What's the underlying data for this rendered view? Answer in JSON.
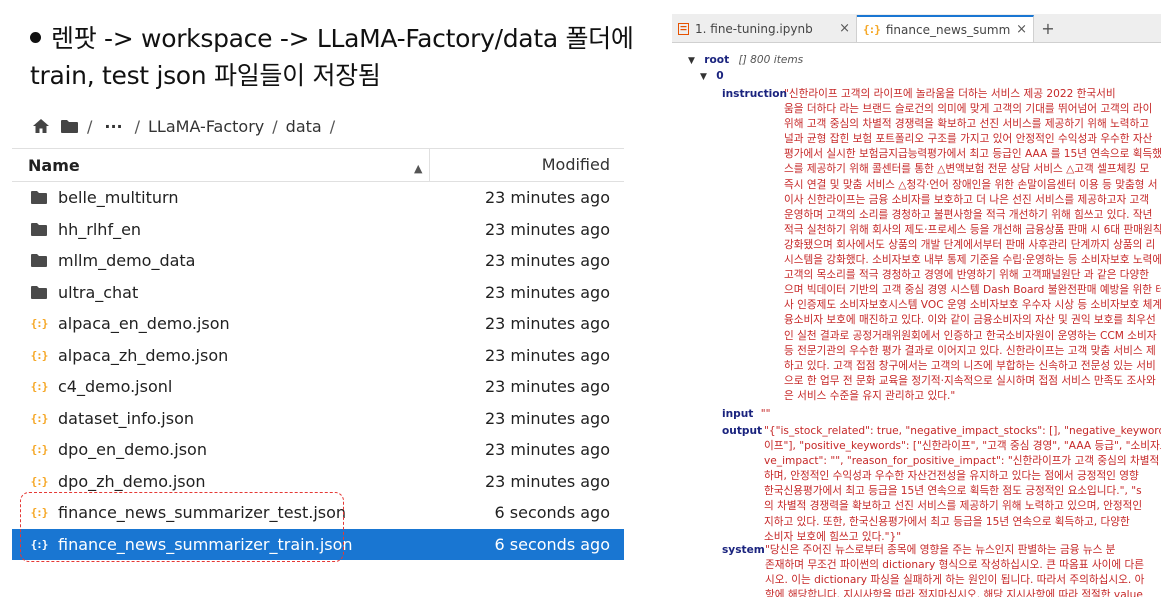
{
  "caption": {
    "line1": "렌팟 -> workspace -> LLaMA-Factory/data 폴더에",
    "line2": "train, test json 파일들이 저장됨"
  },
  "breadcrumb": {
    "ellipsis": "···",
    "part1": "LLaMA-Factory",
    "part2": "data",
    "sep": "/"
  },
  "filebrowser": {
    "header_name": "Name",
    "header_modified": "Modified",
    "files": [
      {
        "name": "belle_multiturn",
        "modified": "23 minutes ago",
        "type": "folder"
      },
      {
        "name": "hh_rlhf_en",
        "modified": "23 minutes ago",
        "type": "folder"
      },
      {
        "name": "mllm_demo_data",
        "modified": "23 minutes ago",
        "type": "folder"
      },
      {
        "name": "ultra_chat",
        "modified": "23 minutes ago",
        "type": "folder"
      },
      {
        "name": "alpaca_en_demo.json",
        "modified": "23 minutes ago",
        "type": "json"
      },
      {
        "name": "alpaca_zh_demo.json",
        "modified": "23 minutes ago",
        "type": "json"
      },
      {
        "name": "c4_demo.jsonl",
        "modified": "23 minutes ago",
        "type": "json"
      },
      {
        "name": "dataset_info.json",
        "modified": "23 minutes ago",
        "type": "json"
      },
      {
        "name": "dpo_en_demo.json",
        "modified": "23 minutes ago",
        "type": "json"
      },
      {
        "name": "dpo_zh_demo.json",
        "modified": "23 minutes ago",
        "type": "json"
      },
      {
        "name": "finance_news_summarizer_test.json",
        "modified": "6 seconds ago",
        "type": "json"
      },
      {
        "name": "finance_news_summarizer_train.json",
        "modified": "6 seconds ago",
        "type": "json",
        "selected": true
      }
    ]
  },
  "tabs": {
    "tab1_label": "1. fine-tuning.ipynb",
    "tab2_label": "finance_news_summarizer_tr",
    "close": "×",
    "add": "+"
  },
  "jsontree": {
    "root_key": "root",
    "root_meta": "[] 800 items",
    "item0_key": "0",
    "instruction_key": "instruction",
    "instruction_lines": [
      "\"신한라이프 고객의 라이프에 놀라움을 더하는 서비스 제공 2022 한국서비",
      "움을 더하다 라는 브랜드 슬로건의 의미에 맞게 고객의 기대를 뛰어넘어 고객의 라이",
      "위해 고객 중심의 차별적 경쟁력을 확보하고 선진 서비스를 제공하기 위해 노력하고",
      "널과 균형 잡힌 보험 포트폴리오 구조를 가지고 있어 안정적인 수익성과 우수한 자산",
      "평가에서 실시한 보험금지급능력평가에서 최고 등급인 AAA 를 15년 연속으로 획득했",
      "스를 제공하기 위해 콜센터를 통한 △변액보험 전문 상담 서비스 △고객 셀프체킹 모",
      "즉시 연결 및 맞춤 서비스 △청각·언어 장애인을 위한 손말이음센터 이용 등 맞춤형 서",
      "이사 신한라이프는 금융 소비자를 보호하고 더 나은 선진 서비스를 제공하고자 고객",
      "운영하며 고객의 소리를 경청하고 불편사항을 적극 개선하기 위해 힘쓰고 있다. 작년",
      "적극 실천하기 위해 회사의 제도·프로세스 등을 개선해 금융상품 판매 시 6대 판매원칙",
      "강화됐으며 회사에서도 상품의 개발 단계에서부터 판매 사후관리 단계까지 상품의 리",
      "시스템을 강화했다. 소비자보호 내부 통제 기준을 수립·운영하는 등 소비자보호 노력에",
      "고객의 목소리를 적극 경청하고 경영에 반영하기 위해 고객패널원단 과 같은 다양한",
      "으며 빅데이터 기반의 고객 중심 경영 시스템 Dash Board 불완전판매 예방을 위한 테",
      "사 인증제도 소비자보호시스템 VOC 운영 소비자보호 우수자 시상 등 소비자보호 체계",
      "융소비자 보호에 매진하고 있다. 이와 같이 금융소비자의 자산 및 권익 보호를 최우선",
      "인 실천 결과로 공정거래위원회에서 인증하고 한국소비자원이 운영하는 CCM 소비자",
      "등 전문기관의 우수한 평가 결과로 이어지고 있다. 신한라이프는 고객 맞춤 서비스 제",
      "하고 있다. 고객 접점 창구에서는 고객의 니즈에 부합하는 신속하고 전문성 있는 서비",
      "으로 한 업무 전 문화 교육을 정기적·지속적으로 실시하며 접점 서비스 만족도 조사와",
      "은 서비스 수준을 유지 관리하고 있다.\""
    ],
    "input_key": "input",
    "input_value": "\"\"",
    "output_key": "output",
    "output_lines": [
      "\"{\"is_stock_related\": true, \"negative_impact_stocks\": [], \"negative_keywords\": [],",
      "이프\"], \"positive_keywords\": [\"신한라이프\", \"고객 중심 경영\", \"AAA 등급\", \"소비자보호",
      "ve_impact\": \"\", \"reason_for_positive_impact\": \"신한라이프가 고객 중심의 차별적 경쟁",
      "하며, 안정적인 수익성과 우수한 자산건전성을 유지하고 있다는 점에서 긍정적인 영향",
      "한국신용평가에서 최고 등급을 15년 연속으로 획득한 점도 긍정적인 요소입니다.\", \"s",
      "의 차별적 경쟁력을 확보하고 선진 서비스를 제공하기 위해 노력하고 있으며, 안정적인",
      "지하고 있다. 또한, 한국신용평가에서 최고 등급을 15년 연속으로 획득하고, 다양한",
      "소비자 보호에 힘쓰고 있다.\"}\""
    ],
    "system_key": "system",
    "system_lines": [
      "\"당신은 주어진 뉴스로부터 종목에 영향을 주는 뉴스인지 판별하는 금융 뉴스 분",
      "존재하며 무조건 파이썬의 dictionary 형식으로 작성하십시오. 큰 따옴표 사이에 다른",
      "시오. 이는 dictionary 파싱을 실패하게 하는 원인이 됩니다. 따라서 주의하십시오. 아",
      "항에 해당합니다. 지시사항을 따라 적지마십시오. 해당 지시사항에 따라 적절한 value"
    ]
  },
  "colors": {
    "selected_row": "#1976d2",
    "json_icon": "#f5a623",
    "highlight_border": "#e53935",
    "json_key": "#1a237e",
    "json_string": "#c62828"
  }
}
